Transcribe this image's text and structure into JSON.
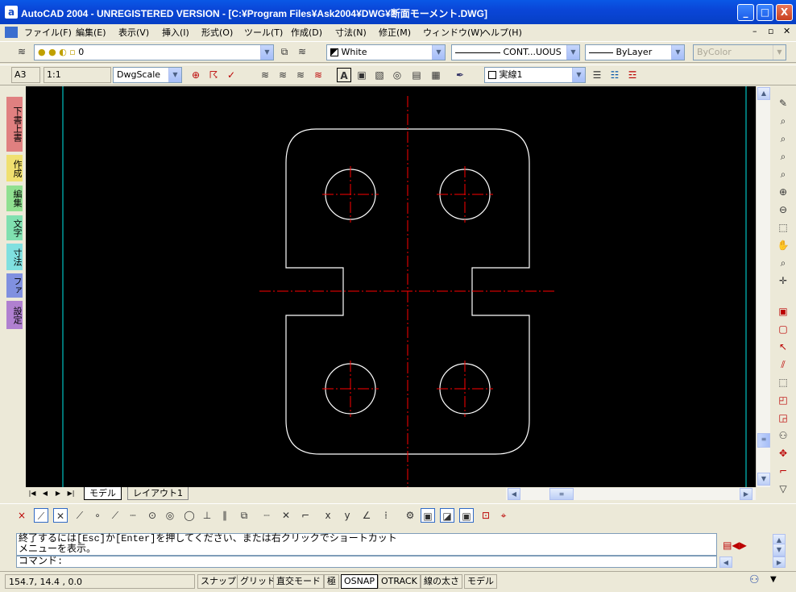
{
  "window": {
    "title": "AutoCAD 2004 - UNREGISTERED VERSION - [C:¥Program Files¥Ask2004¥DWG¥断面モーメント.DWG]",
    "app_icon_letter": "a",
    "minimize": "_",
    "maximize": "□",
    "close": "X"
  },
  "menu": {
    "items": [
      "ファイル(F)",
      "編集(E)",
      "表示(V)",
      "挿入(I)",
      "形式(O)",
      "ツール(T)",
      "作成(D)",
      "寸法(N)",
      "修正(M)",
      "ウィンドウ(W)",
      "ヘルプ(H)"
    ],
    "doc_controls": [
      "–",
      "▫",
      "✕"
    ]
  },
  "layers_toolbar": {
    "layer_value": "0",
    "color_value": "White",
    "linetype_value": "CONT...UOUS",
    "lineweight_value": "ByLayer",
    "plotstyle_value": "ByColor"
  },
  "second_toolbar": {
    "paper": "A3",
    "scale": "1:1",
    "dwgscale": "DwgScale",
    "linestyle": "実線1"
  },
  "left_palette": {
    "tabs": [
      {
        "label": "下書上書",
        "color": "#e08080"
      },
      {
        "label": "作成",
        "color": "#f0e070"
      },
      {
        "label": "編集",
        "color": "#90e090"
      },
      {
        "label": "文字",
        "color": "#80e0b0"
      },
      {
        "label": "寸法",
        "color": "#80e0e0"
      },
      {
        "label": "ファ",
        "color": "#8090e0"
      },
      {
        "label": "設定",
        "color": "#b080d0"
      }
    ]
  },
  "drawing_tabs": {
    "model": "モデル",
    "layout": "レイアウト1"
  },
  "command": {
    "history": "終了するには[Esc]か[Enter]を押してください、または右クリックでショートカット\nメニューを表示。",
    "prompt": "コマンド:"
  },
  "status": {
    "coords": "154.7, 14.4 , 0.0",
    "buttons": [
      {
        "label": "スナップ",
        "on": false
      },
      {
        "label": "グリッド",
        "on": false
      },
      {
        "label": "直交モード",
        "on": false
      },
      {
        "label": "極",
        "on": false
      },
      {
        "label": "OSNAP",
        "on": true
      },
      {
        "label": "OTRACK",
        "on": false
      },
      {
        "label": "線の太さ",
        "on": false
      },
      {
        "label": "モデル",
        "on": false
      }
    ]
  },
  "colors": {
    "canvas_bg": "#000000",
    "geometry": "#ffffff",
    "centerline": "#ff0000",
    "cyan_guide": "#00c0c0",
    "titlebar": "#0a46d8"
  }
}
